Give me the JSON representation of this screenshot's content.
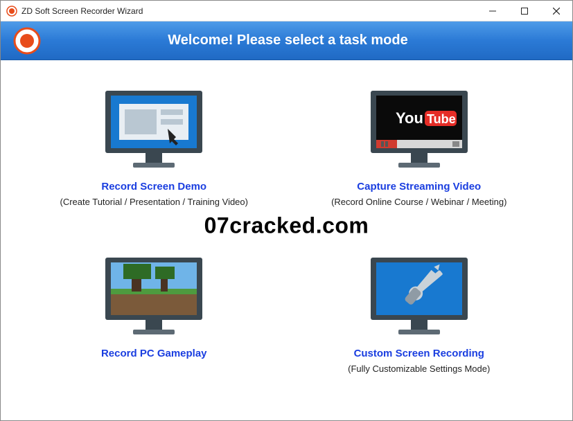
{
  "window": {
    "title": "ZD Soft Screen Recorder Wizard"
  },
  "header": {
    "welcome": "Welcome! Please select a task mode"
  },
  "options": {
    "demo": {
      "title": "Record Screen Demo",
      "sub": "(Create Tutorial / Presentation / Training Video)"
    },
    "streaming": {
      "title": "Capture Streaming Video",
      "sub": "(Record Online Course / Webinar / Meeting)",
      "youtube_prefix": "You",
      "youtube_suffix": "Tube"
    },
    "gameplay": {
      "title": "Record PC Gameplay",
      "sub": ""
    },
    "custom": {
      "title": "Custom Screen Recording",
      "sub": "(Fully Customizable Settings Mode)"
    }
  },
  "watermark": "07cracked.com"
}
